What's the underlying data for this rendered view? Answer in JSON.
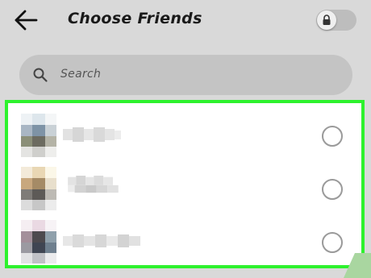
{
  "header": {
    "title": "Choose Friends",
    "back_icon": "arrow-left-icon",
    "lock_toggle": {
      "icon": "lock-icon",
      "on": false
    }
  },
  "search": {
    "placeholder": "Search",
    "icon": "search-icon"
  },
  "friends": [
    {
      "name": "",
      "selected": false
    },
    {
      "name": "",
      "selected": false
    },
    {
      "name": "",
      "selected": false
    }
  ],
  "colors": {
    "highlight": "#2df22d",
    "background": "#d9d9d9",
    "search_bg": "#c4c4c4",
    "radio_border": "#9a9a9a"
  }
}
